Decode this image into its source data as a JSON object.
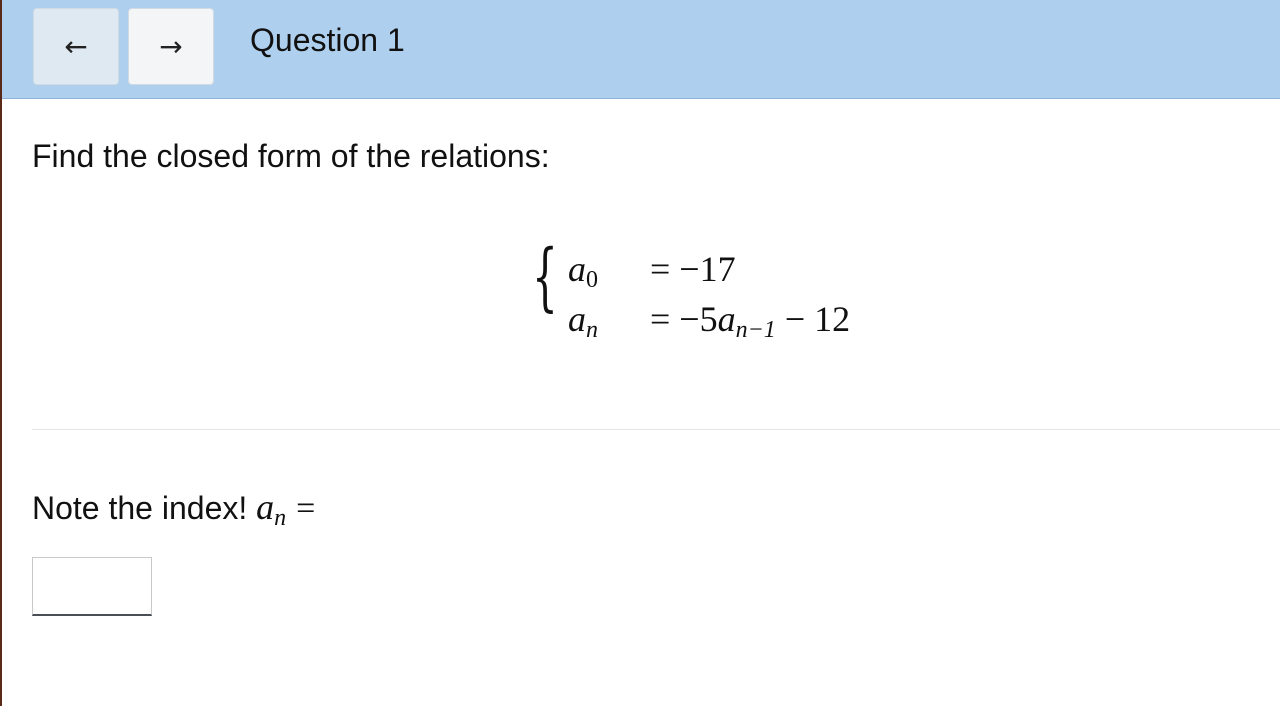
{
  "header": {
    "back_label": "←",
    "forward_label": "→",
    "title": "Question 1"
  },
  "question": {
    "prompt": "Find the closed form of the relations:",
    "system": {
      "row1": {
        "lhs_base": "a",
        "lhs_sub": "0",
        "rhs": "= −17"
      },
      "row2": {
        "lhs_base": "a",
        "lhs_sub": "n",
        "rhs_prefix": "= −5",
        "rhs_var": "a",
        "rhs_sub": "n−1",
        "rhs_suffix": " − 12"
      }
    }
  },
  "answer": {
    "note_text": "Note the index! ",
    "var_base": "a",
    "var_sub": "n",
    "equals": "=",
    "input_value": "",
    "input_placeholder": ""
  }
}
